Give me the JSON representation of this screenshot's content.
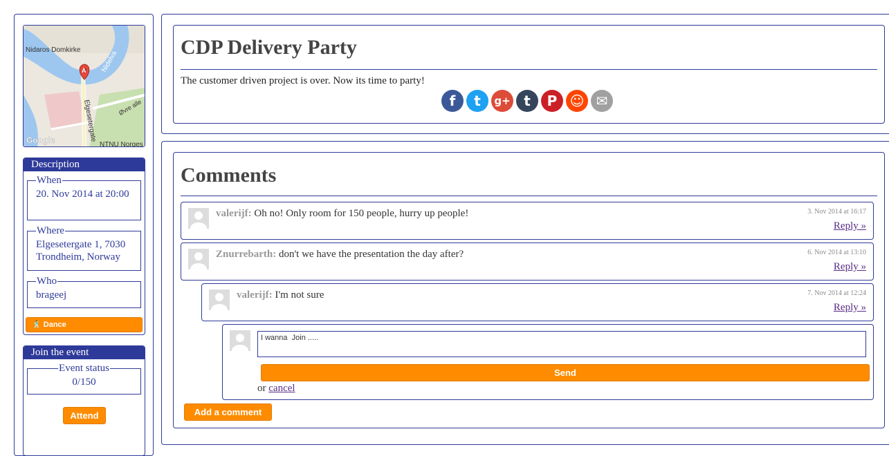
{
  "map": {
    "labels": {
      "poi_cathedral": "Nidaros Domkirke",
      "river": "Nidelva",
      "street_main": "Elgesetergate",
      "street_side": "Øvre alle",
      "poi_ntnu": "NTNU Norges",
      "marker": "A",
      "logo": "Google"
    }
  },
  "description": {
    "header": "Description",
    "when_legend": "When",
    "when_value": "20. Nov 2014 at 20:00",
    "where_legend": "Where",
    "where_value": "Elgesetergate 1, 7030 Trondheim, Norway",
    "who_legend": "Who",
    "who_value": "brageej",
    "tag_label": "Dance"
  },
  "join": {
    "header": "Join the event",
    "status_legend": "Event status",
    "status_value": "0/150",
    "attend_label": "Attend"
  },
  "event": {
    "title": "CDP Delivery Party",
    "text": "The customer driven project is over. Now its time to party!"
  },
  "share": [
    {
      "name": "facebook-icon",
      "glyph": "f",
      "color": "#3b5998"
    },
    {
      "name": "twitter-icon",
      "glyph": "t",
      "color": "#1da1f2"
    },
    {
      "name": "google-plus-icon",
      "glyph": "g+",
      "color": "#dd4b39"
    },
    {
      "name": "tumblr-icon",
      "glyph": "t",
      "color": "#35465c"
    },
    {
      "name": "pinterest-icon",
      "glyph": "P",
      "color": "#cb2027"
    },
    {
      "name": "reddit-icon",
      "glyph": "☺",
      "color": "#ff4500"
    },
    {
      "name": "email-icon",
      "glyph": "✉",
      "color": "#a0a0a0"
    }
  ],
  "comments": {
    "title": "Comments",
    "items": [
      {
        "author": "valerijf:",
        "text": "Oh no! Only room for 150 people, hurry up people!",
        "time": "3. Nov 2014 at 16:17",
        "reply": "Reply »"
      },
      {
        "author": "Znurrebarth:",
        "text": "don't we have the presentation the day after?",
        "time": "6. Nov 2014 at 13:10",
        "reply": "Reply »"
      },
      {
        "author": "valerijf:",
        "text": "I'm not sure",
        "time": "7. Nov 2014 at 12:24",
        "reply": "Reply »"
      }
    ],
    "reply_form": {
      "value": "I wanna  Join .....",
      "send_label": "Send",
      "or_text": "or",
      "cancel_label": "cancel"
    },
    "add_label": "Add a comment"
  }
}
